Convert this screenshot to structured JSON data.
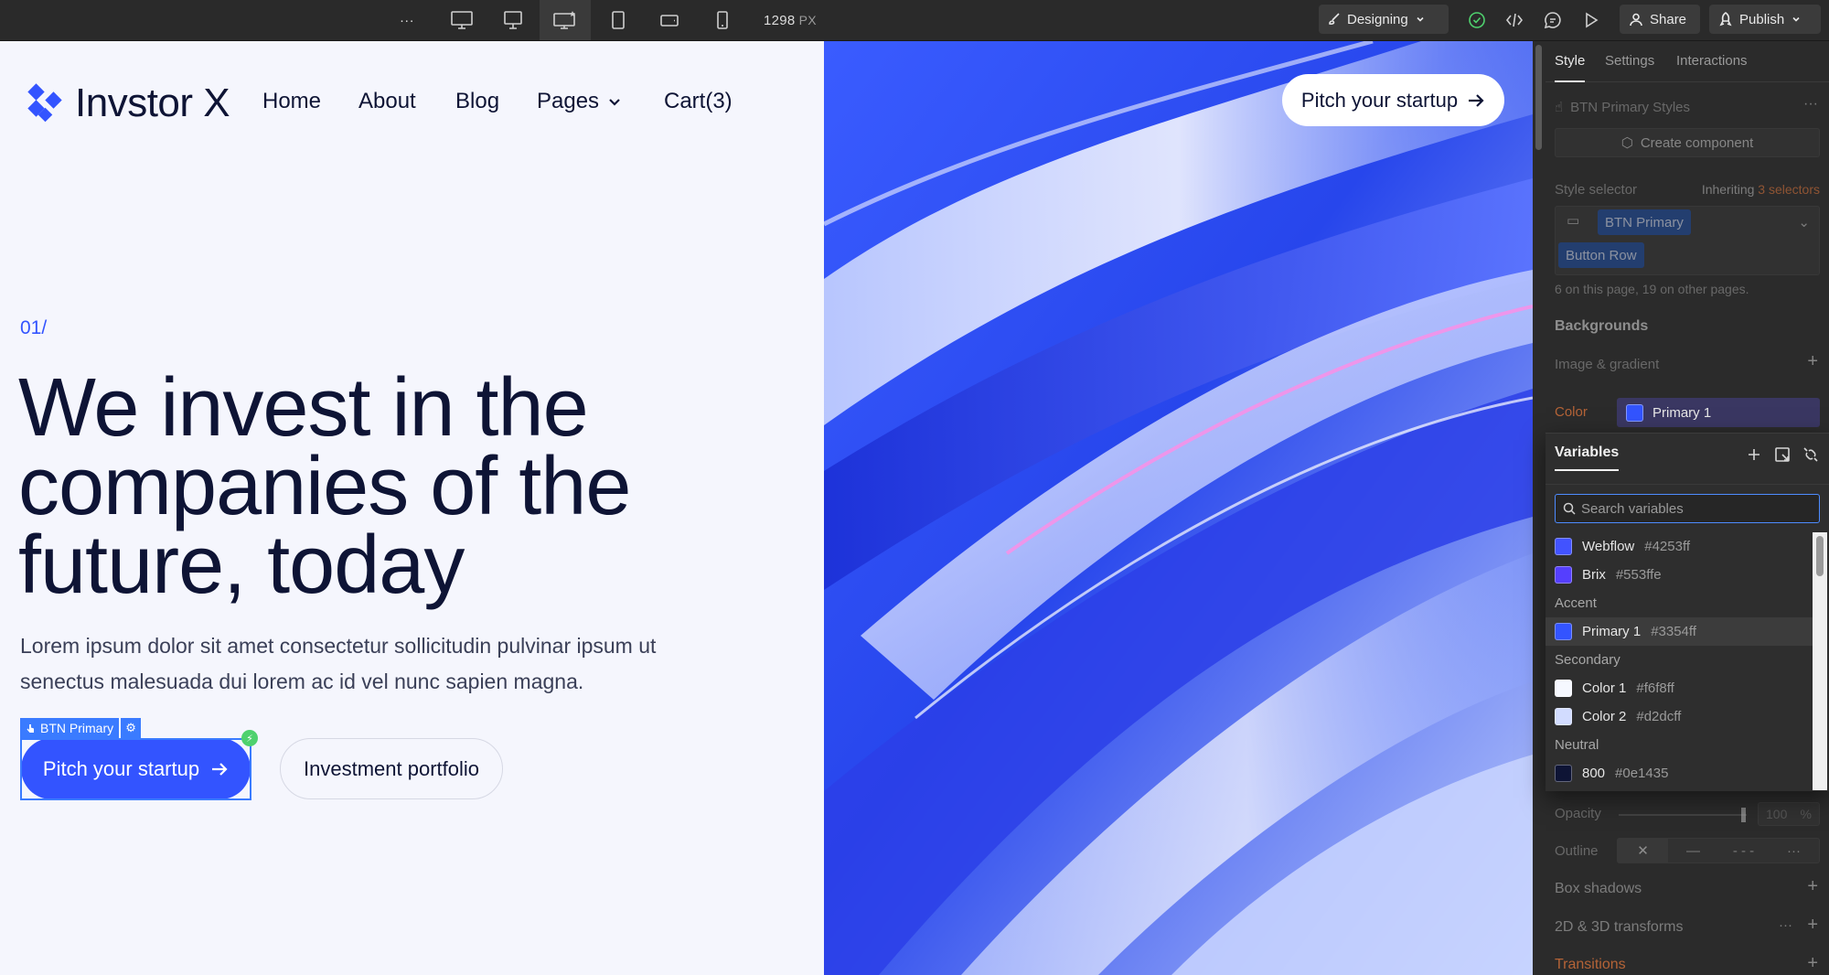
{
  "toolbar": {
    "more_label": "···",
    "width_value": "1298",
    "width_unit": "PX",
    "mode_label": "Designing",
    "share_label": "Share",
    "publish_label": "Publish"
  },
  "site": {
    "logo_text": "Invstor X",
    "nav": [
      {
        "label": "Home"
      },
      {
        "label": "About"
      },
      {
        "label": "Blog"
      },
      {
        "label": "Pages"
      },
      {
        "label": "Cart(3)"
      }
    ],
    "top_cta": "Pitch your startup",
    "eyebrow": "01/",
    "headline": "We invest in the companies of the future, today",
    "paragraph": "Lorem ipsum dolor sit amet consectetur sollicitudin pulvinar ipsum ut senectus malesuada dui lorem ac id vel nunc sapien magna.",
    "primary_cta": "Pitch your startup",
    "secondary_cta": "Investment portfolio",
    "selection_tag": "BTN Primary"
  },
  "panel": {
    "tabs": [
      "Style",
      "Settings",
      "Interactions"
    ],
    "element_label": "BTN Primary Styles",
    "create_component": "Create component",
    "style_selector_label": "Style selector",
    "inheriting_prefix": "Inheriting",
    "inheriting_count": "3 selectors",
    "selector_chip": "BTN Primary",
    "combo_chip": "Button Row",
    "usage_note": "6 on this page, 19 on other pages.",
    "backgrounds_label": "Backgrounds",
    "image_gradient_label": "Image & gradient",
    "color_label": "Color",
    "color_value": "Primary 1",
    "opacity_label": "Opacity",
    "opacity_value": "100",
    "opacity_unit": "%",
    "outline_label": "Outline",
    "box_shadows_label": "Box shadows",
    "transforms_label": "2D & 3D transforms",
    "transitions_label": "Transitions"
  },
  "variables": {
    "title": "Variables",
    "search_placeholder": "Search variables",
    "items": [
      {
        "type": "var",
        "name": "Webflow",
        "hex": "#4253ff",
        "color": "#4253ff"
      },
      {
        "type": "var",
        "name": "Brix",
        "hex": "#553ffe",
        "color": "#553ffe"
      },
      {
        "type": "group",
        "name": "Accent"
      },
      {
        "type": "var",
        "name": "Primary 1",
        "hex": "#3354ff",
        "color": "#3354ff",
        "selected": true
      },
      {
        "type": "group",
        "name": "Secondary"
      },
      {
        "type": "var",
        "name": "Color 1",
        "hex": "#f6f8ff",
        "color": "#f6f8ff"
      },
      {
        "type": "var",
        "name": "Color 2",
        "hex": "#d2dcff",
        "color": "#d2dcff"
      },
      {
        "type": "group",
        "name": "Neutral"
      },
      {
        "type": "var",
        "name": "800",
        "hex": "#0e1435",
        "color": "#0e1435"
      }
    ]
  },
  "colors": {
    "accent": "#3354ff",
    "dark": "#0e1435",
    "canvas_bg": "#f5f6fd"
  }
}
